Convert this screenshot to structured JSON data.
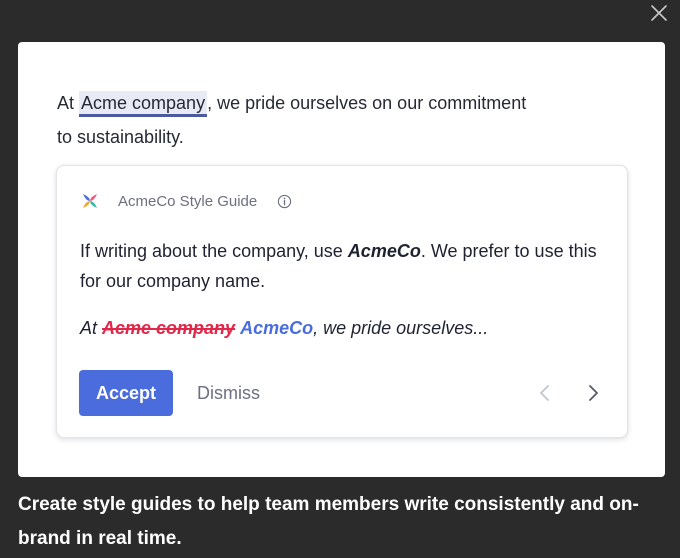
{
  "sentence": {
    "prefix": "At ",
    "highlight": "Acme company",
    "suffix": ", we pride ourselves on our commitment to sustainability."
  },
  "guide": {
    "name": "AcmeCo Style Guide",
    "logo_icon": "style-guide-logo-icon",
    "info_icon": "info-icon",
    "rule_prefix": "If writing about the company, use ",
    "rule_brand": "AcmeCo",
    "rule_suffix": ". We prefer to use this for our company name.",
    "example_prefix": "At ",
    "example_removed": "Acme company",
    "example_space": " ",
    "example_added": "AcmeCo",
    "example_suffix": ", we pride ourselves..."
  },
  "actions": {
    "accept_label": "Accept",
    "dismiss_label": "Dismiss",
    "prev_icon": "chevron-left-icon",
    "next_icon": "chevron-right-icon"
  },
  "close_icon": "close-icon",
  "caption": "Create style guides to help team members write consistently and on-brand in real time.",
  "colors": {
    "background": "#2b2b2c",
    "card": "#ffffff",
    "accent": "#4a6cdc",
    "removed": "#e0284a",
    "highlight_underline": "#4a5a9c"
  }
}
